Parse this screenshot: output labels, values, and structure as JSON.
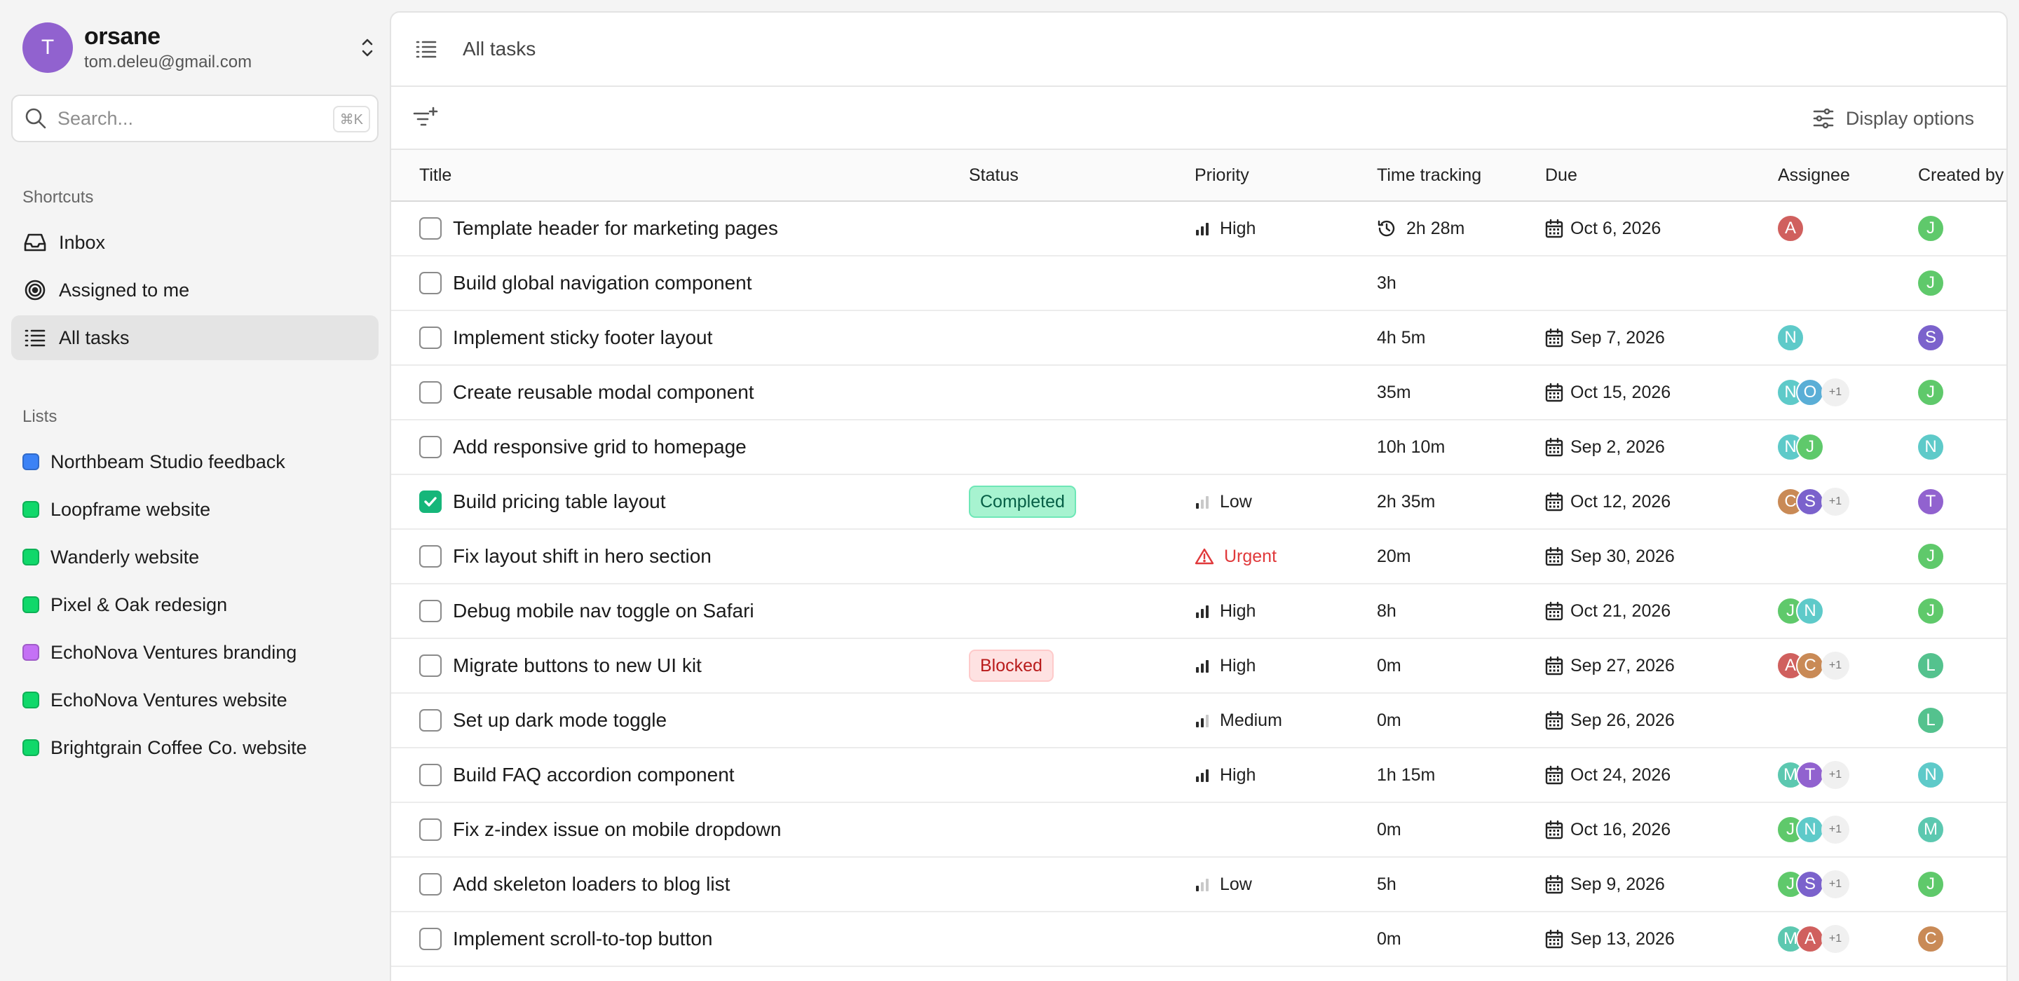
{
  "profile": {
    "initial": "T",
    "name": "orsane",
    "email": "tom.deleu@gmail.com"
  },
  "search": {
    "placeholder": "Search...",
    "shortcut": "⌘K"
  },
  "shortcuts": {
    "label": "Shortcuts",
    "items": [
      {
        "label": "Inbox",
        "icon": "inbox-icon"
      },
      {
        "label": "Assigned to me",
        "icon": "target-icon"
      },
      {
        "label": "All tasks",
        "icon": "list-icon",
        "active": true
      }
    ]
  },
  "lists": {
    "label": "Lists",
    "items": [
      {
        "label": "Northbeam Studio feedback",
        "color": "#3b82f6"
      },
      {
        "label": "Loopframe website",
        "color": "#10d86a"
      },
      {
        "label": "Wanderly website",
        "color": "#10d86a"
      },
      {
        "label": "Pixel & Oak redesign",
        "color": "#10d86a"
      },
      {
        "label": "EchoNova Ventures branding",
        "color": "#c471f5"
      },
      {
        "label": "EchoNova Ventures website",
        "color": "#10d86a"
      },
      {
        "label": "Brightgrain Coffee Co. website",
        "color": "#10d86a"
      }
    ]
  },
  "header": {
    "title": "All tasks",
    "display_options": "Display options"
  },
  "table": {
    "columns": [
      "Title",
      "Status",
      "Priority",
      "Time tracking",
      "Due",
      "Assignee",
      "Created by"
    ],
    "rows": [
      {
        "title": "Template header for marketing pages",
        "checked": false,
        "status": "",
        "priority": "High",
        "time": "2h 28m",
        "timer_running": true,
        "due": "Oct 6, 2026",
        "assignees": [
          "A"
        ],
        "more": "",
        "created_by": "J"
      },
      {
        "title": "Build global navigation component",
        "checked": false,
        "status": "",
        "priority": "",
        "time": "3h",
        "due": "",
        "assignees": [],
        "more": "",
        "created_by": "J"
      },
      {
        "title": "Implement sticky footer layout",
        "checked": false,
        "status": "",
        "priority": "",
        "time": "4h 5m",
        "due": "Sep 7, 2026",
        "assignees": [
          "N"
        ],
        "more": "",
        "created_by": "S"
      },
      {
        "title": "Create reusable modal component",
        "checked": false,
        "status": "",
        "priority": "",
        "time": "35m",
        "due": "Oct 15, 2026",
        "assignees": [
          "N",
          "O"
        ],
        "more": "+1",
        "created_by": "J"
      },
      {
        "title": "Add responsive grid to homepage",
        "checked": false,
        "status": "",
        "priority": "",
        "time": "10h 10m",
        "due": "Sep 2, 2026",
        "assignees": [
          "N",
          "J"
        ],
        "more": "",
        "created_by": "N"
      },
      {
        "title": "Build pricing table layout",
        "checked": true,
        "status": "Completed",
        "priority": "Low",
        "time": "2h 35m",
        "due": "Oct 12, 2026",
        "assignees": [
          "C",
          "S"
        ],
        "more": "+1",
        "created_by": "T"
      },
      {
        "title": "Fix layout shift in hero section",
        "checked": false,
        "status": "",
        "priority": "Urgent",
        "time": "20m",
        "due": "Sep 30, 2026",
        "assignees": [],
        "more": "",
        "created_by": "J"
      },
      {
        "title": "Debug mobile nav toggle on Safari",
        "checked": false,
        "status": "",
        "priority": "High",
        "time": "8h",
        "due": "Oct 21, 2026",
        "assignees": [
          "J",
          "N"
        ],
        "more": "",
        "created_by": "J"
      },
      {
        "title": "Migrate buttons to new UI kit",
        "checked": false,
        "status": "Blocked",
        "priority": "High",
        "time": "0m",
        "due": "Sep 27, 2026",
        "assignees": [
          "A",
          "C"
        ],
        "more": "+1",
        "created_by": "L"
      },
      {
        "title": "Set up dark mode toggle",
        "checked": false,
        "status": "",
        "priority": "Medium",
        "time": "0m",
        "due": "Sep 26, 2026",
        "assignees": [],
        "more": "",
        "created_by": "L"
      },
      {
        "title": "Build FAQ accordion component",
        "checked": false,
        "status": "",
        "priority": "High",
        "time": "1h 15m",
        "due": "Oct 24, 2026",
        "assignees": [
          "M",
          "T"
        ],
        "more": "+1",
        "created_by": "N"
      },
      {
        "title": "Fix z-index issue on mobile dropdown",
        "checked": false,
        "status": "",
        "priority": "",
        "time": "0m",
        "due": "Oct 16, 2026",
        "assignees": [
          "J",
          "N"
        ],
        "more": "+1",
        "created_by": "M"
      },
      {
        "title": "Add skeleton loaders to blog list",
        "checked": false,
        "status": "",
        "priority": "Low",
        "time": "5h",
        "due": "Sep 9, 2026",
        "assignees": [
          "J",
          "S"
        ],
        "more": "+1",
        "created_by": "J"
      },
      {
        "title": "Implement scroll-to-top button",
        "checked": false,
        "status": "",
        "priority": "",
        "time": "0m",
        "due": "Sep 13, 2026",
        "assignees": [
          "M",
          "A"
        ],
        "more": "+1",
        "created_by": "C"
      }
    ]
  },
  "colors": {
    "avatars": {
      "A": "#d0605e",
      "J": "#5fc96b",
      "N": "#5ecac9",
      "O": "#5aaed6",
      "S": "#7b62cc",
      "C": "#c98a56",
      "T": "#9162cf",
      "L": "#54c28e",
      "M": "#5cc8b0"
    },
    "status": {
      "Completed": {
        "bg": "#a7f3d0",
        "fg": "#065f46",
        "border": "#6ee7b7"
      },
      "Blocked": {
        "bg": "#fee2e2",
        "fg": "#b91c1c",
        "border": "#fecaca"
      }
    },
    "urgent": "#e0393b"
  }
}
